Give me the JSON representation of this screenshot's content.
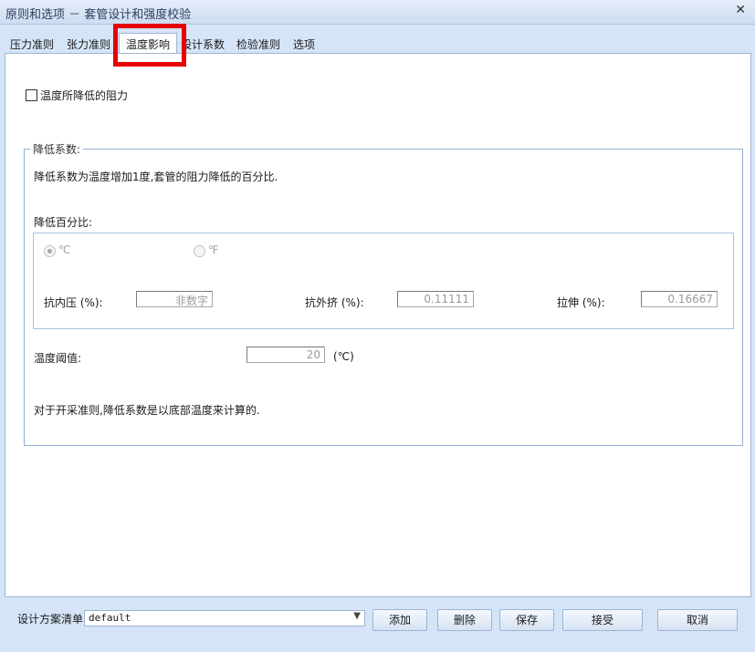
{
  "window": {
    "title": "原则和选项 － 套管设计和强度校验",
    "close_glyph": "✕"
  },
  "tabs": [
    {
      "label": "压力准则"
    },
    {
      "label": "张力准则"
    },
    {
      "label": "温度影响",
      "active": true
    },
    {
      "label": "设计系数"
    },
    {
      "label": "检验准则"
    },
    {
      "label": "选项"
    }
  ],
  "temperature": {
    "checkbox_label": "温度所降低的阻力",
    "checked": false,
    "group": {
      "legend": "降低系数:",
      "description": "降低系数为温度增加1度,套管的阻力降低的百分比.",
      "percent_label": "降低百分比:",
      "unit_celsius": "℃",
      "unit_fahrenheit": "℉",
      "selected_unit": "℃",
      "burst_label": "抗内压 (%):",
      "burst_value": "非数字",
      "collapse_label": "抗外挤 (%):",
      "collapse_value": "0.11111",
      "tension_label": "拉伸 (%):",
      "tension_value": "0.16667",
      "threshold_label": "温度阈值:",
      "threshold_value": "20",
      "threshold_unit": "(℃)",
      "note": "对于开采准则,降低系数是以底部温度来计算的."
    }
  },
  "bottom": {
    "plan_label": "设计方案清单",
    "plan_value": "default",
    "buttons": {
      "add": "添加",
      "delete": "删除",
      "save": "保存",
      "accept": "接受",
      "cancel": "取消"
    }
  },
  "colors": {
    "highlight": "#e60000",
    "frame": "#d5e4f7",
    "group_border": "#8fb2d3"
  }
}
